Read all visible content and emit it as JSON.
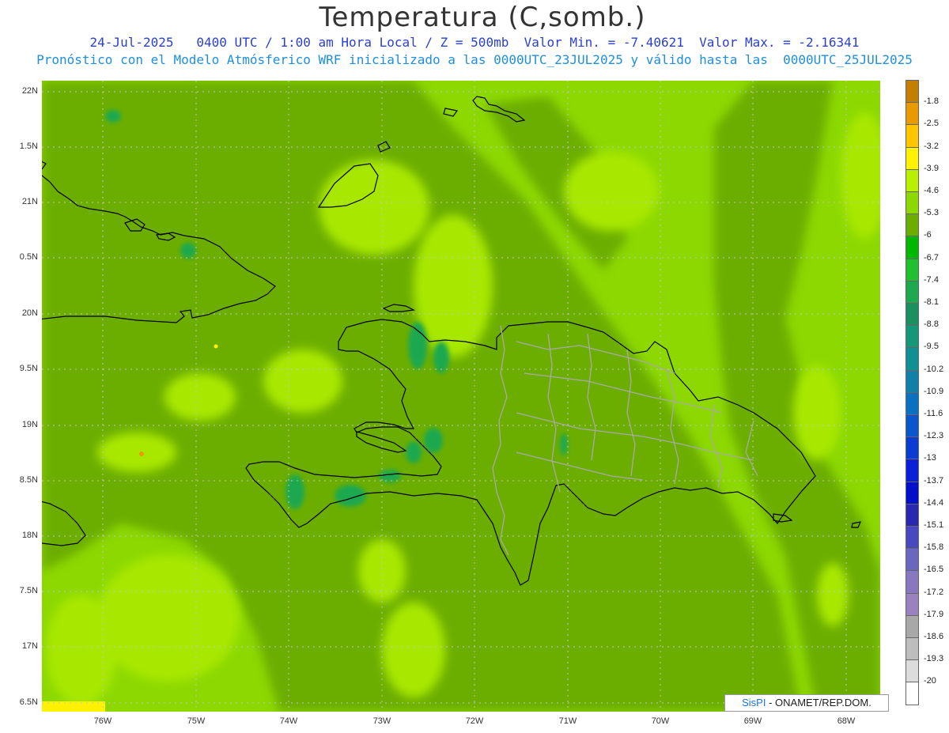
{
  "header": {
    "title": "Temperatura (C,somb.)",
    "line1": "24-Jul-2025   0400 UTC / 1:00 am Hora Local / Z = 500mb  Valor Min. = -7.40621  Valor Max. = -2.16341",
    "line2": "Pronóstico con el Modelo Atmósferico WRF inicializado a las 0000UTC_23JUL2025 y válido hasta las  0000UTC_25JUL2025"
  },
  "axes": {
    "lat_labels": [
      "22N",
      "1.5N",
      "21N",
      "0.5N",
      "20N",
      "9.5N",
      "19N",
      "8.5N",
      "18N",
      "7.5N",
      "17N",
      "6.5N"
    ],
    "lon_labels": [
      "76W",
      "75W",
      "74W",
      "73W",
      "72W",
      "71W",
      "70W",
      "69W",
      "68W"
    ]
  },
  "credit": {
    "brand": "SisPI",
    "text": " - ONAMET/REP.DOM."
  },
  "colorbar": {
    "labels": [
      "-1.8",
      "-2.5",
      "-3.2",
      "-3.9",
      "-4.6",
      "-5.3",
      "-6",
      "-6.7",
      "-7.4",
      "-8.1",
      "-8.8",
      "-9.5",
      "-10.2",
      "-10.9",
      "-11.6",
      "-12.3",
      "-13",
      "-13.7",
      "-14.4",
      "-15.1",
      "-15.8",
      "-16.5",
      "-17.2",
      "-17.9",
      "-18.6",
      "-19.3",
      "-20"
    ],
    "colors": [
      "#c47f00",
      "#e89a00",
      "#ffc600",
      "#fff200",
      "#b8f000",
      "#8cd800",
      "#6cae00",
      "#00b800",
      "#20c030",
      "#1ea850",
      "#1a9060",
      "#149878",
      "#109090",
      "#1080a8",
      "#0a70c0",
      "#0a56cc",
      "#0a3cd4",
      "#0a20d8",
      "#0010c8",
      "#2828b0",
      "#4848c0",
      "#6868c0",
      "#8878c0",
      "#9a82c0",
      "#a8a8a8",
      "#bdbdbd",
      "#dcdcdc",
      "#ffffff"
    ]
  },
  "chart_data": {
    "type": "heatmap",
    "title": "Temperatura (C,somb.)",
    "valid_time": "24-Jul-2025 0400 UTC / 1:00 am Hora Local",
    "level": "Z = 500mb",
    "value_min": -7.40621,
    "value_max": -2.16341,
    "model_init": "0000UTC_23JUL2025",
    "valid_until": "0000UTC_25JUL2025",
    "lat_ticks": [
      "22N",
      "1.5N",
      "21N",
      "0.5N",
      "20N",
      "9.5N",
      "19N",
      "8.5N",
      "18N",
      "7.5N",
      "17N",
      "6.5N"
    ],
    "lon_ticks": [
      "76W",
      "75W",
      "74W",
      "73W",
      "72W",
      "71W",
      "70W",
      "69W",
      "68W"
    ],
    "colorbar_levels": [
      -1.8,
      -2.5,
      -3.2,
      -3.9,
      -4.6,
      -5.3,
      -6,
      -6.7,
      -7.4,
      -8.1,
      -8.8,
      -9.5,
      -10.2,
      -10.9,
      -11.6,
      -12.3,
      -13,
      -13.7,
      -14.4,
      -15.1,
      -15.8,
      -16.5,
      -17.2,
      -17.9,
      -18.6,
      -19.3,
      -20
    ],
    "grid": true
  }
}
